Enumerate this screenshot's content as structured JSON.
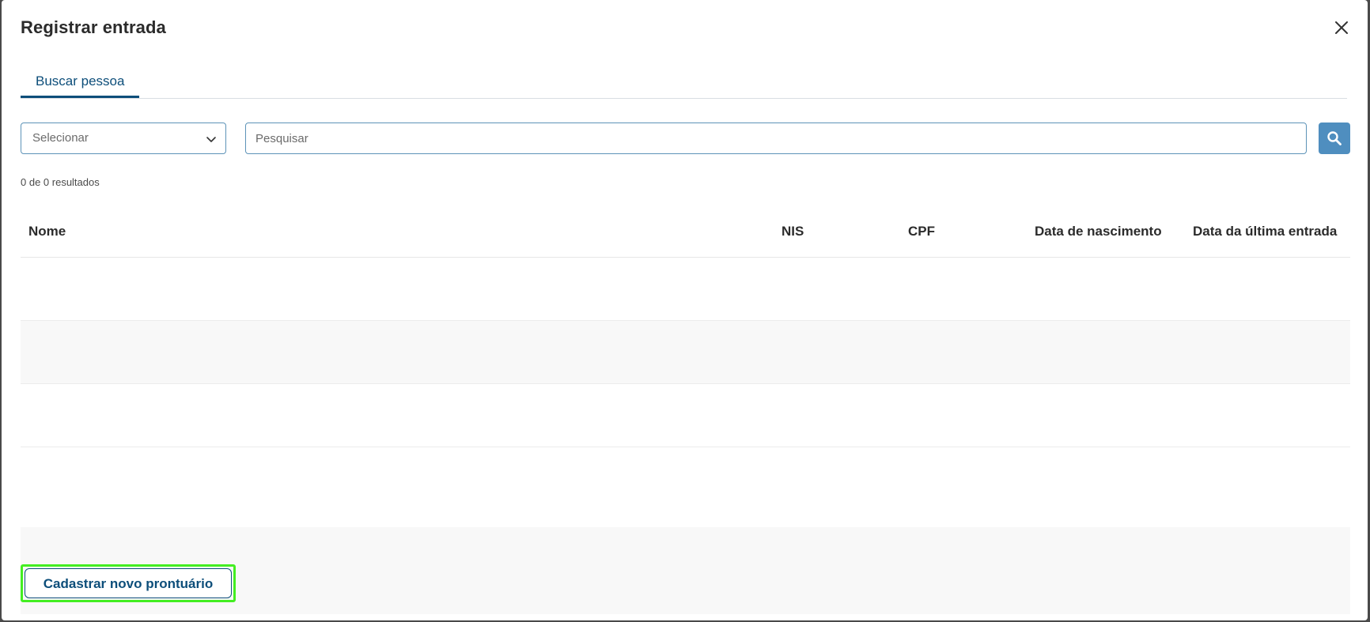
{
  "modal": {
    "title": "Registrar entrada"
  },
  "tabs": [
    {
      "label": "Buscar pessoa",
      "active": true
    }
  ],
  "search": {
    "select_placeholder": "Selecionar",
    "input_placeholder": "Pesquisar",
    "input_value": ""
  },
  "results": {
    "summary": "0 de 0 resultados"
  },
  "table": {
    "columns": [
      "Nome",
      "NIS",
      "CPF",
      "Data de nascimento",
      "Data da última entrada"
    ],
    "rows": []
  },
  "footer": {
    "new_button_label": "Cadastrar novo prontuário"
  },
  "colors": {
    "accent": "#0d4e7a",
    "search_button": "#4f8ebf",
    "highlight_outline": "#44ee22"
  },
  "icons": {
    "close": "close-icon",
    "chevron": "chevron-down-icon",
    "search": "search-icon"
  }
}
